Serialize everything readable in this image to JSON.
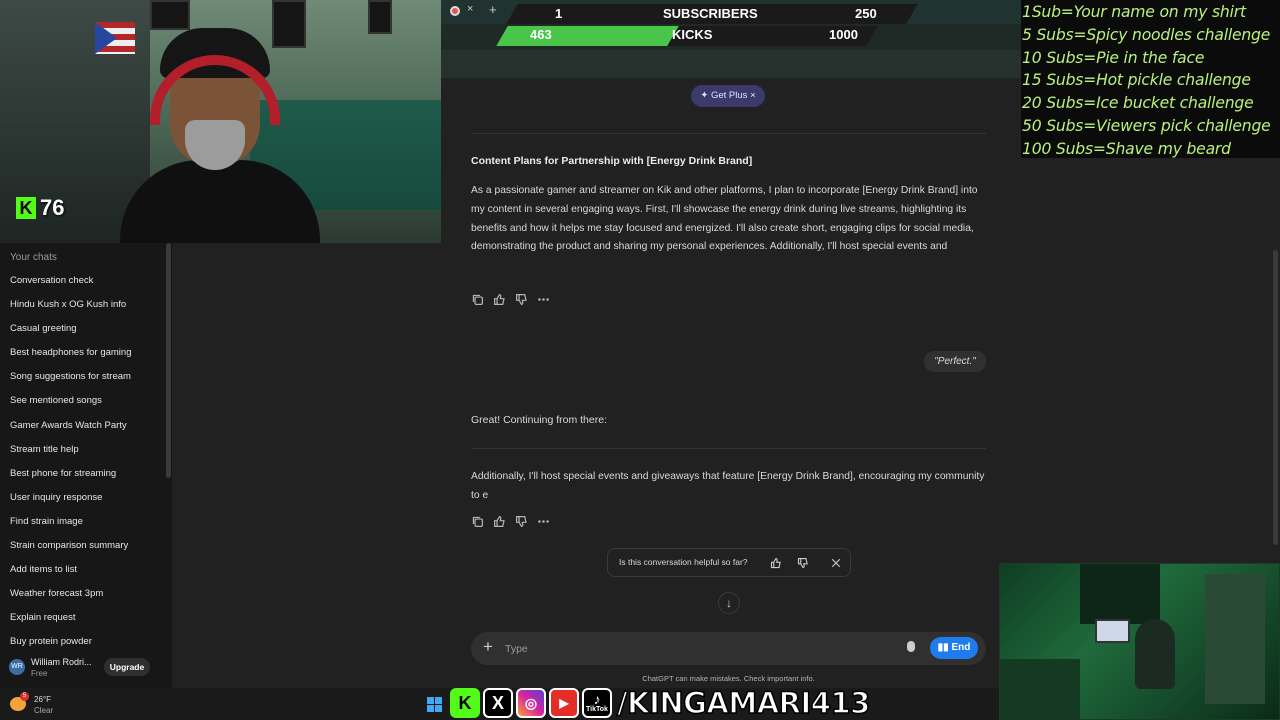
{
  "stream": {
    "kick_count": "76",
    "sub_goal": {
      "current": "1",
      "label": "SUBSCRIBERS",
      "target": "250",
      "progress": 0.004
    },
    "kick_goal": {
      "current": "463",
      "label": "KICKS",
      "target": "1000",
      "progress": 0.463
    },
    "goals": [
      "1Sub=Your name on my shirt",
      "5 Subs=Spicy noodles challenge",
      "10 Subs=Pie in the face",
      "15 Subs=Hot pickle challenge",
      "20 Subs=Ice bucket challenge",
      "50 Subs=Viewers pick challenge",
      "100 Subs=Shave my beard"
    ],
    "handle": "/KINGAMARI413",
    "social_icons": [
      "kick-icon",
      "x-icon",
      "instagram-icon",
      "youtube-icon",
      "tiktok-icon"
    ],
    "tiktok_label": "TikTok"
  },
  "sidebar": {
    "header": "Your chats",
    "chats": [
      "Conversation check",
      "Hindu Kush x OG Kush info",
      "Casual greeting",
      "Best headphones for gaming",
      "Song suggestions for stream",
      "See mentioned songs",
      "Gamer Awards Watch Party",
      "Stream title help",
      "Best phone for streaming",
      "User inquiry response",
      "Find strain image",
      "Strain comparison summary",
      "Add items to list",
      "Weather forecast 3pm",
      "Explain request",
      "Buy protein powder"
    ],
    "user": {
      "initials": "WR",
      "name": "William Rodri...",
      "plan": "Free",
      "upgrade_label": "Upgrade"
    }
  },
  "browser": {
    "close_tab": "×",
    "new_tab": "+"
  },
  "chat": {
    "get_plus": "✦ Get Plus",
    "get_plus_close": "×",
    "reply1_title": "Content Plans for Partnership with [Energy Drink Brand]",
    "reply1_body": "As a passionate gamer and streamer on Kik and other platforms, I plan to incorporate [Energy Drink Brand] into my content in several engaging ways. First, I'll showcase the energy drink during live streams, highlighting its benefits and how it helps me stay focused and energized. I'll also create short, engaging clips for social media, demonstrating the product and sharing my personal experiences. Additionally, I'll host special events and",
    "user_message": "\"Perfect.\"",
    "reply2_intro": "Great! Continuing from there:",
    "reply2_body": "Additionally, I'll host special events and giveaways that feature [Energy Drink Brand], encouraging my community to e",
    "feedback_question": "Is this conversation helpful so far?",
    "composer_placeholder": "Type",
    "end_label": "End",
    "disclaimer": "ChatGPT can make mistakes. Check important info."
  },
  "taskbar": {
    "weather_badge": "5",
    "temperature": "26°F",
    "condition": "Clear"
  },
  "colors": {
    "kick_green": "#53fc18",
    "goal_text": "#b9f27a",
    "end_button": "#1e7cf0",
    "get_plus_bg": "#3b3a6b",
    "progress_green": "#49c64a"
  }
}
